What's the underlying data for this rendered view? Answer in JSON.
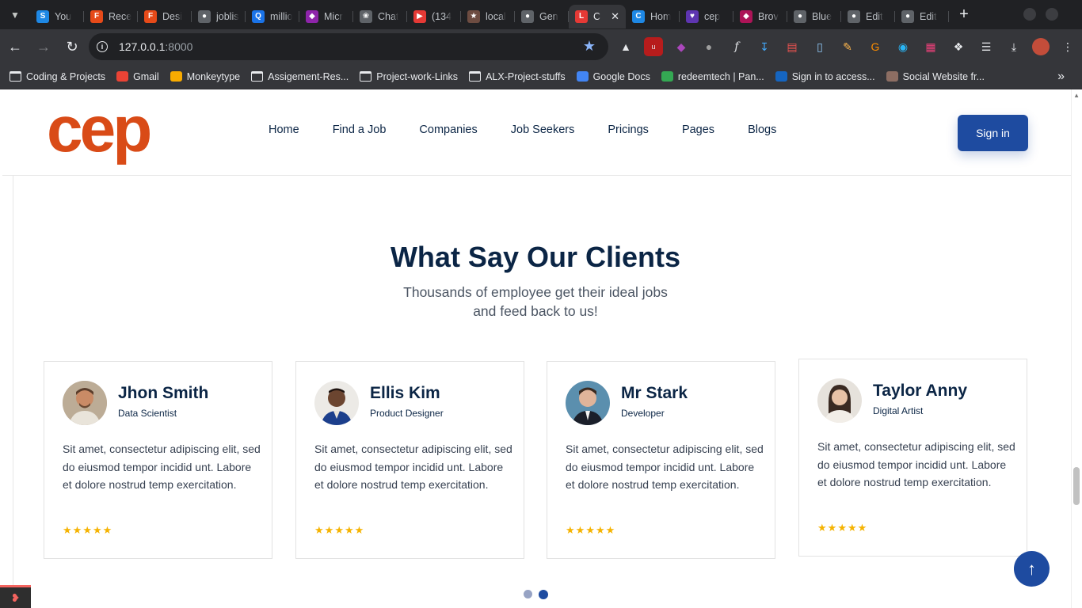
{
  "browser": {
    "tabs": [
      {
        "label": "You",
        "fav": "S",
        "color": "#1e88e5"
      },
      {
        "label": "Rece",
        "fav": "F",
        "color": "#e64a19"
      },
      {
        "label": "Desi",
        "fav": "F",
        "color": "#e64a19"
      },
      {
        "label": "joblis",
        "fav": "●",
        "color": "#5f6368"
      },
      {
        "label": "millio",
        "fav": "Q",
        "color": "#1a73e8"
      },
      {
        "label": "Micr",
        "fav": "◆",
        "color": "#8e24aa"
      },
      {
        "label": "Chat",
        "fav": "❀",
        "color": "#5f6368"
      },
      {
        "label": "(134",
        "fav": "▶",
        "color": "#e53935"
      },
      {
        "label": "local",
        "fav": "★",
        "color": "#6d4c41"
      },
      {
        "label": "Gen",
        "fav": "●",
        "color": "#5f6368"
      },
      {
        "label": "C",
        "fav": "L",
        "color": "#e53935"
      },
      {
        "label": "Hom",
        "fav": "C",
        "color": "#1e88e5"
      },
      {
        "label": "cep",
        "fav": "♥",
        "color": "#5e35b1"
      },
      {
        "label": "Brov",
        "fav": "◆",
        "color": "#ad1457"
      },
      {
        "label": "Blue",
        "fav": "●",
        "color": "#5f6368"
      },
      {
        "label": "Edit",
        "fav": "●",
        "color": "#5f6368"
      },
      {
        "label": "Edit",
        "fav": "●",
        "color": "#5f6368"
      }
    ],
    "url_host": "127.0.0.1",
    "url_port": ":8000",
    "bookmarks": [
      {
        "label": "Coding & Projects",
        "type": "folder"
      },
      {
        "label": "Gmail",
        "type": "site"
      },
      {
        "label": "Monkeytype",
        "type": "site"
      },
      {
        "label": "Assigement-Res...",
        "type": "folder"
      },
      {
        "label": "Project-work-Links",
        "type": "folder"
      },
      {
        "label": "ALX-Project-stuffs",
        "type": "folder"
      },
      {
        "label": "Google Docs",
        "type": "site"
      },
      {
        "label": "redeemtech | Pan...",
        "type": "site"
      },
      {
        "label": "Sign in to access...",
        "type": "site"
      },
      {
        "label": "Social Website fr...",
        "type": "site"
      }
    ]
  },
  "header": {
    "logo_text": "cep",
    "nav": [
      "Home",
      "Find a Job",
      "Companies",
      "Job Seekers",
      "Pricings",
      "Pages",
      "Blogs"
    ],
    "signin_label": "Sign in"
  },
  "section": {
    "title": "What Say Our Clients",
    "subtitle": "Thousands of employee get their ideal jobs and feed back to us!"
  },
  "testimonials": [
    {
      "name": "Jhon Smith",
      "role": "Data Scientist",
      "text": "Sit amet, consectetur adipiscing elit, sed do eiusmod tempor incidid unt. Labore et dolore nostrud temp exercitation.",
      "stars": 5
    },
    {
      "name": "Ellis Kim",
      "role": "Product Designer",
      "text": "Sit amet, consectetur adipiscing elit, sed do eiusmod tempor incidid unt. Labore et dolore nostrud temp exercitation.",
      "stars": 5
    },
    {
      "name": "Mr Stark",
      "role": "Developer",
      "text": "Sit amet, consectetur adipiscing elit, sed do eiusmod tempor incidid unt. Labore et dolore nostrud temp exercitation.",
      "stars": 5
    },
    {
      "name": "Taylor Anny",
      "role": "Digital Artist",
      "text": "Sit amet, consectetur adipiscing elit, sed do eiusmod tempor incidid unt. Labore et dolore nostrud temp exercitation.",
      "stars": 5
    }
  ],
  "carousel": {
    "pages": 2,
    "active_page": 2
  },
  "colors": {
    "brand": "#d94b17",
    "primary": "#1e4ba0",
    "heading": "#0b2545",
    "star": "#f5b301"
  }
}
